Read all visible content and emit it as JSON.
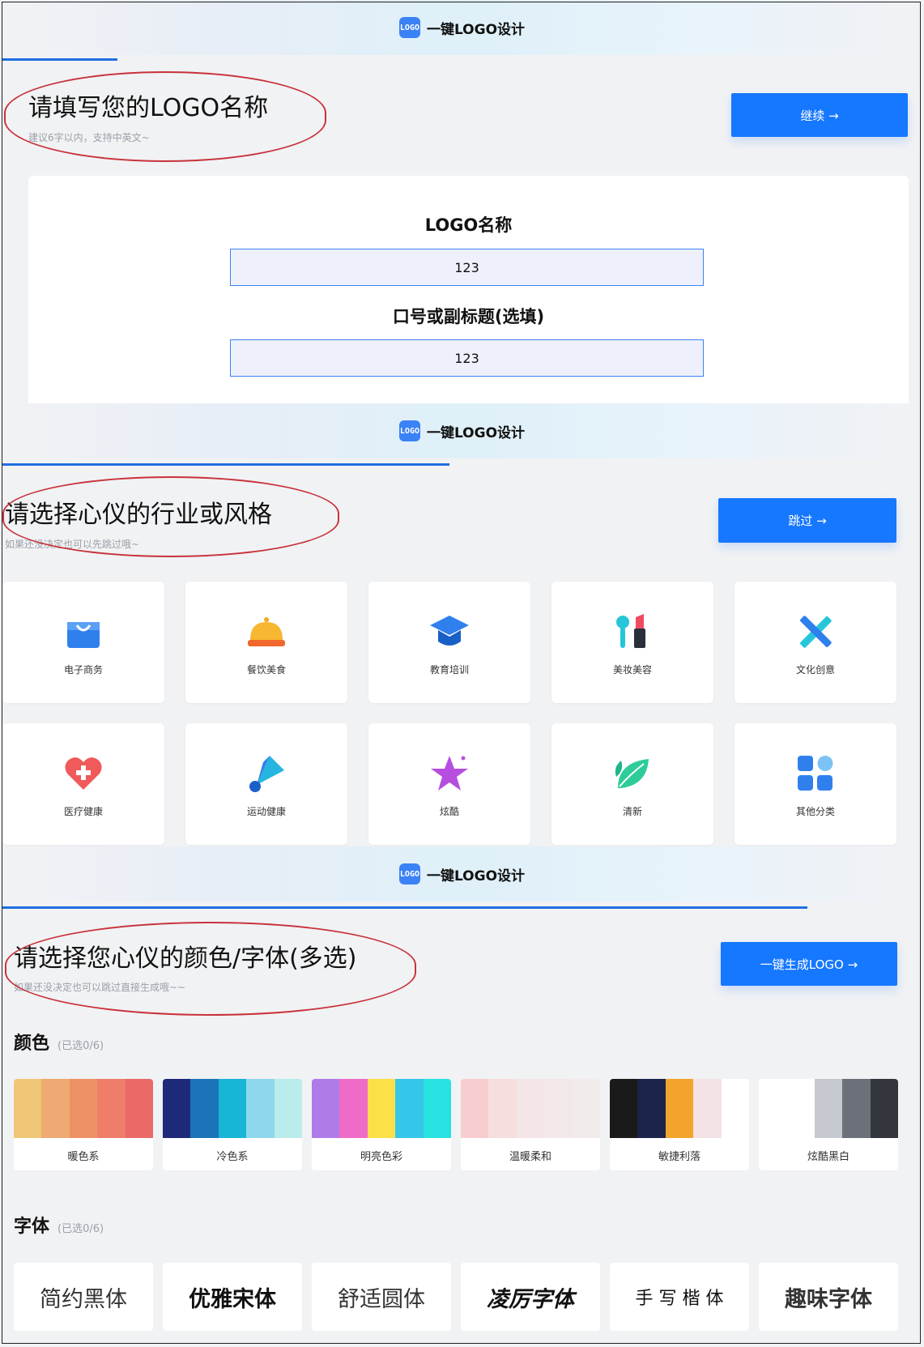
{
  "brand": {
    "name": "一键LOGO设计",
    "icon": "logo-app-icon"
  },
  "step1": {
    "title": "请填写您的LOGO名称",
    "subtitle": "建议6字以内，支持中英文~",
    "button": "继续 →",
    "name_label": "LOGO名称",
    "name_value": "123",
    "slogan_label": "口号或副标题(选填)",
    "slogan_value": "123"
  },
  "step2": {
    "title": "请选择心仪的行业或风格",
    "subtitle": "如果还没决定也可以先跳过哦~",
    "button": "跳过 →",
    "industries": [
      {
        "label": "电子商务",
        "icon": "shopping-bag-icon"
      },
      {
        "label": "餐饮美食",
        "icon": "food-cloche-icon"
      },
      {
        "label": "教育培训",
        "icon": "graduation-cap-icon"
      },
      {
        "label": "美妆美容",
        "icon": "lipstick-icon"
      },
      {
        "label": "文化创意",
        "icon": "pencil-ruler-icon"
      },
      {
        "label": "医疗健康",
        "icon": "heart-plus-icon"
      },
      {
        "label": "运动健康",
        "icon": "shuttlecock-icon"
      },
      {
        "label": "炫酷",
        "icon": "star-icon"
      },
      {
        "label": "清新",
        "icon": "leaf-icon"
      },
      {
        "label": "其他分类",
        "icon": "grid-apps-icon"
      }
    ]
  },
  "step3": {
    "title": "请选择您心仪的颜色/字体(多选)",
    "subtitle": "如果还没决定也可以跳过直接生成哦~~",
    "button": "一键生成LOGO →",
    "color_heading": "颜色",
    "color_count": "(已选0/6)",
    "palettes": [
      {
        "label": "暖色系",
        "colors": [
          "#f0c677",
          "#eeaa72",
          "#ee9167",
          "#ee7e6a",
          "#ea6a68"
        ]
      },
      {
        "label": "冷色系",
        "colors": [
          "#1d2a7a",
          "#1c74b8",
          "#17b5d6",
          "#8ed8ee",
          "#b9ecea"
        ]
      },
      {
        "label": "明亮色彩",
        "colors": [
          "#ad7ce9",
          "#ef6bc7",
          "#fbe047",
          "#35c7ea",
          "#26e3e1"
        ]
      },
      {
        "label": "温暖柔和",
        "colors": [
          "#f7cdd0",
          "#f6dede",
          "#f4e6e6",
          "#f3e8e8",
          "#f2ebeb"
        ]
      },
      {
        "label": "敏捷利落",
        "colors": [
          "#1a1a1a",
          "#1c2449",
          "#f2a42c",
          "#f3e3e4",
          "#ffffff"
        ]
      },
      {
        "label": "炫酷黑白",
        "colors": [
          "#ffffff",
          "#ffffff",
          "#c5c9cf",
          "#6c7078",
          "#33363c"
        ]
      }
    ],
    "font_heading": "字体",
    "font_count": "(已选0/6)",
    "fonts": [
      "简约黑体",
      "优雅宋体",
      "舒适圆体",
      "凌厉字体",
      "手 写 楷 体",
      "趣味字体"
    ]
  },
  "colors": {
    "accent": "#1677ff",
    "annotation": "#c8323a"
  }
}
